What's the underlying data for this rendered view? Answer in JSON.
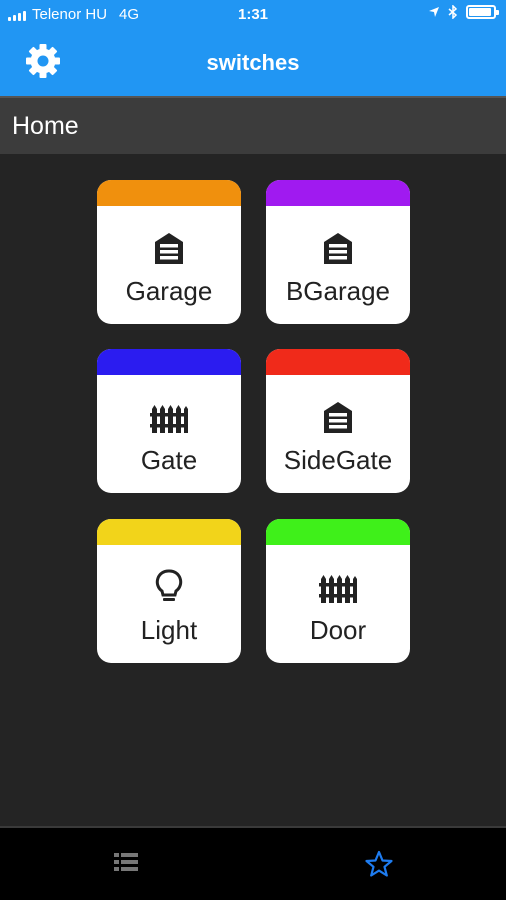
{
  "status": {
    "carrier": "Telenor HU",
    "network": "4G",
    "time": "1:31",
    "battery_level": 0.85
  },
  "navbar": {
    "title": "switches",
    "settings_icon": "gear-icon"
  },
  "section": {
    "title": "Home"
  },
  "tiles": [
    {
      "label": "Garage",
      "color": "#f0900d",
      "icon": "garage-icon"
    },
    {
      "label": "BGarage",
      "color": "#a01af0",
      "icon": "garage-icon"
    },
    {
      "label": "Gate",
      "color": "#2b1cf0",
      "icon": "fence-icon"
    },
    {
      "label": "SideGate",
      "color": "#f02a1a",
      "icon": "garage-icon"
    },
    {
      "label": "Light",
      "color": "#f2d41a",
      "icon": "lightbulb-icon"
    },
    {
      "label": "Door",
      "color": "#3ff01a",
      "icon": "fence-icon"
    }
  ],
  "tabbar": {
    "items": [
      {
        "icon": "list-icon",
        "active": false
      },
      {
        "icon": "star-icon",
        "active": true
      }
    ],
    "active_color": "#1e7cf0",
    "inactive_color": "#777777"
  }
}
